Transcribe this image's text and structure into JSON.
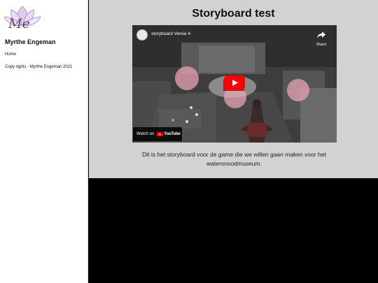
{
  "sidebar": {
    "logo_text": "Me",
    "site_name": "Myrthe Engeman",
    "nav": {
      "home_label": "Home"
    },
    "copyright": "Copy rights - Myrthe Engeman 2021"
  },
  "main": {
    "title": "Storyboard test",
    "video": {
      "title": "storyboard Versie 4",
      "share_label": "Share",
      "watch_on_label": "Watch on",
      "youtube_label": "YouTube"
    },
    "description": "Dit is het storyboard voor de game die we willen gaan maken voor het watersnoodmuseum."
  },
  "colors": {
    "sidebar_bg": "#ffffff",
    "main_bg": "#d2d2d2",
    "lower_bg": "#000000",
    "youtube_red": "#ff0000",
    "logo_purple": "#9b6fc2"
  }
}
